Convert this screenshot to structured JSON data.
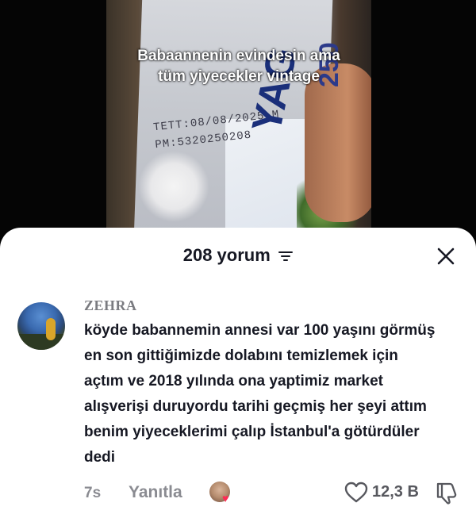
{
  "video": {
    "caption": "Babaannenin evindesin ama\ntüm yiyecekler vintage",
    "carton_stamp_line1": "TETT:08/08/2025 M",
    "carton_stamp_line2": "PM:5320250208",
    "carton_brand": "YAG",
    "carton_size": "250"
  },
  "comments_sheet": {
    "count_label": "208 yorum",
    "sort_icon": "sort-lines-icon",
    "close_icon": "close-x-icon"
  },
  "comment": {
    "username": "ZEHRA",
    "text": "köyde babannemin annesi var 100 yaşını görmüş\nen son gittiğimizde dolabını temizlemek için\naçtım ve 2018 yılında ona yaptimiz market\nalışverişi duruyordu tarihi geçmiş her şeyi attım\nbenim yiyeceklerimi çalıp İstanbul'a götürdüler\ndedi",
    "time": "7s",
    "reply_label": "Yanıtla",
    "like_count": "12,3 B",
    "like_icon": "heart-outline-icon",
    "dislike_icon": "thumbs-down-icon",
    "accent_color": "#fe2c55"
  }
}
